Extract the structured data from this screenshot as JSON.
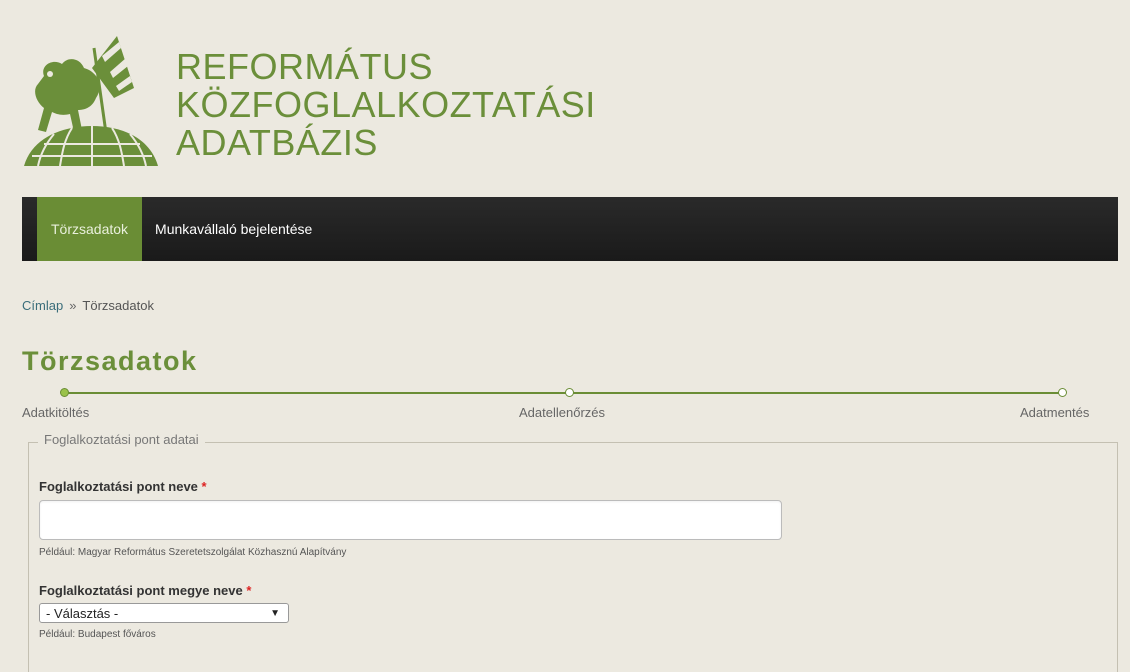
{
  "header": {
    "title_lines": [
      "REFORMÁTUS",
      "KÖZFOGLALKOZTATÁSI",
      "ADATBÁZIS"
    ]
  },
  "nav": {
    "items": [
      {
        "label": "Törzsadatok",
        "active": true
      },
      {
        "label": "Munkavállaló bejelentése",
        "active": false
      }
    ]
  },
  "breadcrumb": {
    "home": "Címlap",
    "separator": "»",
    "current": "Törzsadatok"
  },
  "page": {
    "title": "Törzsadatok"
  },
  "progress": {
    "steps": [
      "Adatkitöltés",
      "Adatellenőrzés",
      "Adatmentés"
    ],
    "current_step": 1
  },
  "form": {
    "fieldset_legend": "Foglalkoztatási pont adatai",
    "name_field": {
      "label": "Foglalkoztatási pont neve",
      "required_mark": "*",
      "value": "",
      "help": "Például: Magyar Református Szeretetszolgálat Közhasznú Alapítvány"
    },
    "county_field": {
      "label": "Foglalkoztatási pont megye neve",
      "required_mark": "*",
      "selected": "- Választás -",
      "arrow": "▼",
      "help": "Például: Budapest főváros"
    }
  },
  "colors": {
    "accent": "#6b8f3a",
    "nav_bg": "#1f1f1f",
    "nav_active": "#6a8d35",
    "page_bg": "#ece9e0"
  }
}
